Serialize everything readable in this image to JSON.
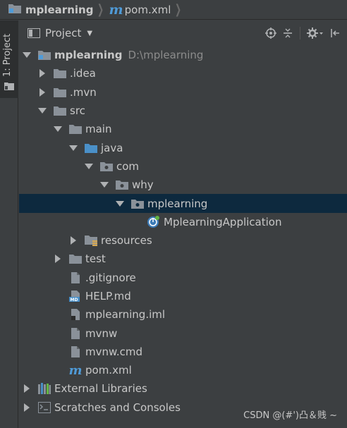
{
  "breadcrumb": {
    "project": "mplearning",
    "file": "pom.xml",
    "file_icon": "m"
  },
  "toolstrip": {
    "tab_label": "1: Project"
  },
  "panel": {
    "title": "Project",
    "tools": [
      "locate-icon",
      "collapse-all-icon",
      "gear-icon",
      "hide-icon"
    ]
  },
  "tree": {
    "root": {
      "label": "mplearning",
      "path": "D:\\mplearning"
    },
    "items": [
      {
        "label": ".idea"
      },
      {
        "label": ".mvn"
      },
      {
        "label": "src"
      },
      {
        "label": "main"
      },
      {
        "label": "java"
      },
      {
        "label": "com"
      },
      {
        "label": "why"
      },
      {
        "label": "mplearning"
      },
      {
        "label": "MplearningApplication"
      },
      {
        "label": "resources"
      },
      {
        "label": "test"
      },
      {
        "label": ".gitignore"
      },
      {
        "label": "HELP.md"
      },
      {
        "label": "mplearning.iml"
      },
      {
        "label": "mvnw"
      },
      {
        "label": "mvnw.cmd"
      },
      {
        "label": "pom.xml"
      },
      {
        "label": "External Libraries"
      },
      {
        "label": "Scratches and Consoles"
      }
    ]
  },
  "watermark": "CSDN @(#')凸＆贱 ~",
  "colors": {
    "background": "#3c3f41",
    "selection": "#0d293e",
    "folder": "#8a9199",
    "java_folder": "#4a90c8",
    "maven": "#4f9bd8"
  }
}
